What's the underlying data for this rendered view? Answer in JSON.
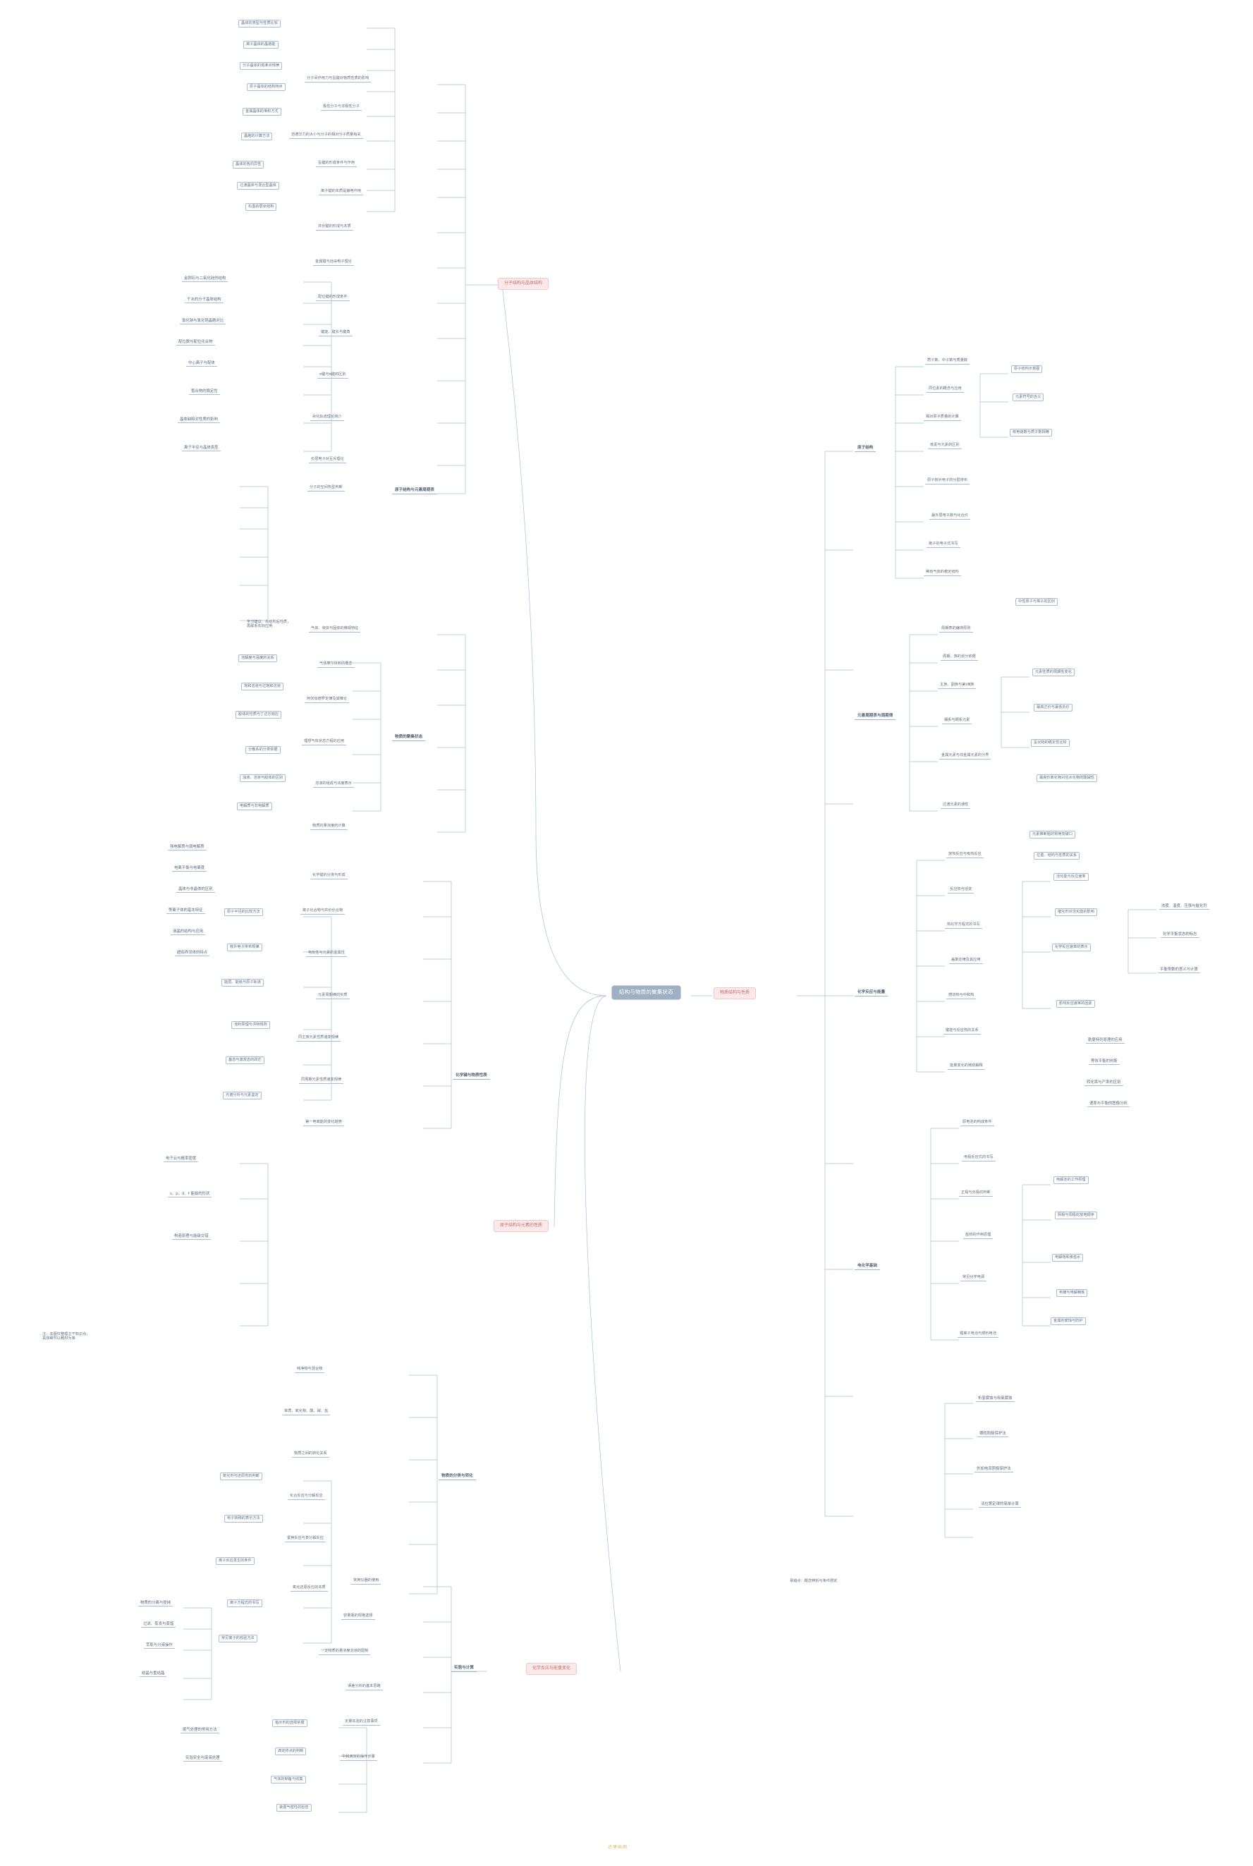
{
  "document": {
    "title": "结构与物质的聚集状态",
    "watermark": "迅捷画图"
  },
  "palette": {
    "root_bg": "#9fb0c4",
    "root_text": "#ffffff",
    "topic_bg": "#fbe9e9",
    "topic_border": "#efc9c9",
    "topic_text": "#b8736f",
    "line": "#a9bed1",
    "node_text": "#5d6e80",
    "background": "#ffffff",
    "watermark": "#d8b24a"
  },
  "root": {
    "label": "结构与物质的聚集状态"
  },
  "topics": [
    {
      "id": "t1",
      "label": "分子结构与晶体结构"
    },
    {
      "id": "t2",
      "label": "原子结构与元素的性质"
    },
    {
      "id": "t3",
      "label": "化学反应与能量变化"
    },
    {
      "id": "t4",
      "label": "物质结构与性质"
    }
  ],
  "left_cluster_a": {
    "branch": "原子结构与元素周期表",
    "nodes": [
      "分子间作用力与氢键对物质性质的影响",
      "极性分子与非极性分子",
      "范德华力的大小与分子的相对分子质量有关",
      "氢键的形成条件与作用",
      "离子键的本质是静电作用",
      "共价键的形成与本质",
      "金属键与自由电子理论",
      "配位键的形成条件",
      "键能、键长与键角",
      "σ键与π键的区别",
      "杂化轨道理论简介",
      "价层电子对互斥理论",
      "分子的空间构型判断",
      "晶体的类型与性质比较",
      "离子晶体的晶格能",
      "分子晶体的熔沸点规律",
      "原子晶体的结构特点",
      "金属晶体的堆积方式",
      "晶胞的计算方法",
      "晶体的各向异性",
      "过渡晶体与混合型晶体",
      "石墨的层状结构",
      "金刚石与二氧化硅的结构",
      "干冰的分子晶体结构",
      "氯化钠与氯化铯晶胞对比",
      "配位数与配位化合物",
      "中心离子与配体",
      "螯合物的稳定性",
      "晶体缺陷对性质的影响",
      "离子半径与晶体类型"
    ]
  },
  "left_cluster_b": {
    "branch": "物质的聚集状态",
    "nodes": [
      "气体、液体与固体的微观特征",
      "气体摩尔体积的概念",
      "阿伏加德罗定律及其推论",
      "理想气体状态方程的应用",
      "溶液的组成与浓度表示",
      "物质的量浓度的计算",
      "溶解度与温度的关系",
      "饱和溶液与过饱和溶液",
      "胶体的性质与丁达尔效应",
      "分散系的分类依据",
      "浊液、溶液与胶体的区别",
      "电解质与非电解质",
      "强电解质与弱电解质",
      "电离平衡与电离度",
      "晶体与非晶体的区别",
      "等离子体的基本特征",
      "液晶的结构与应用",
      "超临界流体的特点"
    ]
  },
  "left_cluster_c": {
    "branch": "化学键与物质性质",
    "nodes": [
      "化学键的分类与形成",
      "离子化合物与共价化合物",
      "电负性与元素的金属性",
      "元素周期律的实质",
      "同主族元素性质递变规律",
      "同周期元素性质递变规律",
      "第一电离能的变化趋势",
      "原子半径的比较方法",
      "核外电子排布规律",
      "能层、能级与原子轨道",
      "泡利原理与洪特规则",
      "基态与激发态的跃迁",
      "光谱分析与元素鉴定",
      "电子云与概率密度",
      "s、p、d、f 能级的形状",
      "构造原理与能级交错"
    ]
  },
  "left_cluster_d": {
    "branch": "物质的分类与转化",
    "nodes": [
      "纯净物与混合物",
      "单质、氧化物、酸、碱、盐",
      "物质之间的转化关系",
      "化合反应与分解反应",
      "置换反应与复分解反应",
      "氧化还原反应的本质",
      "氧化剂与还原剂的判断",
      "电子转移的表示方法",
      "离子反应发生的条件",
      "离子方程式的书写",
      "常见离子的检验方法",
      "物质的分离与提纯",
      "过滤、蒸发与蒸馏",
      "萃取与分液操作",
      "结晶与重结晶"
    ]
  },
  "right_cluster_a": {
    "branch": "原子结构",
    "nodes": [
      "质子数、中子数与质量数",
      "同位素的概念与应用",
      "相对原子质量的计算",
      "核素与元素的区别",
      "原子核外电子的分层排布",
      "最外层电子数与化合价",
      "离子的电子式书写",
      "稀有气体的稳定结构",
      "原子结构示意图",
      "元素符号的含义",
      "核电荷数与质子数相等",
      "中性原子与离子的区别"
    ]
  },
  "right_cluster_b": {
    "branch": "元素周期表与周期律",
    "nodes": [
      "周期表的编排原则",
      "周期、族的划分依据",
      "主族、副族与第Ⅷ族",
      "镧系与锕系元素",
      "金属元素与非金属元素的分界",
      "过渡元素的通性",
      "元素性质的周期性变化",
      "最高正价与最低负价",
      "氢化物的稳定性比较",
      "最高价氧化物对应水化物的酸碱性",
      "元素推断题的常用突破口",
      "位置、结构与性质的关系"
    ]
  },
  "right_cluster_c": {
    "branch": "化学反应与能量",
    "nodes": [
      "放热反应与吸热反应",
      "反应热与焓变",
      "热化学方程式的书写",
      "盖斯定律及其应用",
      "燃烧热与中和热",
      "键能与反应热的关系",
      "能量变化的微观解释",
      "活化能与反应速率",
      "催化剂对活化能的影响",
      "化学反应速率的表示",
      "影响反应速率的因素",
      "浓度、温度、压强与催化剂",
      "化学平衡状态的标志",
      "平衡常数的意义与计算",
      "勒夏特列原理的应用",
      "等效平衡的判断",
      "转化率与产率的区别",
      "速率与平衡的图像分析"
    ]
  },
  "right_cluster_d": {
    "branch": "电化学基础",
    "nodes": [
      "原电池的构成条件",
      "电极反应式的书写",
      "正极与负极的判断",
      "盐桥的作用原理",
      "常见化学电源",
      "锂离子电池与燃料电池",
      "电解池的工作原理",
      "阴极与阳极的放电顺序",
      "电解饱和食盐水",
      "电镀与电解精炼",
      "金属的腐蚀与防护",
      "析氢腐蚀与吸氧腐蚀",
      "牺牲阳极保护法",
      "外加电流阴极保护法",
      "法拉第定律的简单计算"
    ]
  },
  "bottom_cluster": {
    "branch": "实验与计算",
    "nodes": [
      "常用仪器的使用",
      "容量瓶的规格选择",
      "一定物质的量浓度溶液的配制",
      "误差分析的基本思路",
      "定量实验的注意事项",
      "中和滴定的操作步骤",
      "指示剂的选择依据",
      "滴定终点的判断",
      "气体的制备与收集",
      "装置气密性的检查",
      "尾气处理的常用方法",
      "实验安全与废液处理"
    ]
  },
  "side_notes": [
    "注：本图仅整理主干知识点，\n具体细节以教材为准",
    "学习建议：先结构后性质，\n再联系实际应用",
    "易错点：概念辨析与条件限定"
  ]
}
